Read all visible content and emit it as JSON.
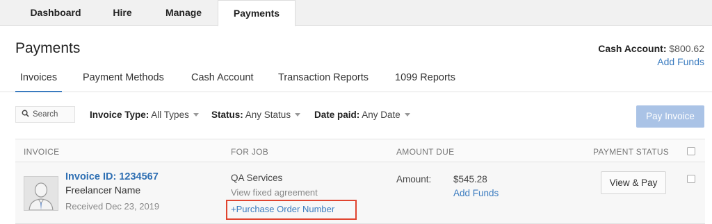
{
  "top_tabs": [
    {
      "label": "Dashboard"
    },
    {
      "label": "Hire"
    },
    {
      "label": "Manage"
    },
    {
      "label": "Payments",
      "active": true
    }
  ],
  "page": {
    "title": "Payments"
  },
  "cash_account": {
    "label": "Cash Account:",
    "amount": "$800.62",
    "add_funds": "Add Funds"
  },
  "sub_tabs": [
    {
      "label": "Invoices",
      "active": true
    },
    {
      "label": "Payment Methods"
    },
    {
      "label": "Cash Account"
    },
    {
      "label": "Transaction Reports"
    },
    {
      "label": "1099 Reports"
    }
  ],
  "filters": {
    "search_label": "Search",
    "invoice_type": {
      "label": "Invoice Type:",
      "value": "All Types"
    },
    "status": {
      "label": "Status:",
      "value": "Any Status"
    },
    "date_paid": {
      "label": "Date paid:",
      "value": "Any Date"
    },
    "pay_invoice": "Pay Invoice"
  },
  "table": {
    "headers": [
      "INVOICE",
      "FOR JOB",
      "AMOUNT DUE",
      "PAYMENT STATUS"
    ],
    "rows": [
      {
        "invoice_id": "Invoice ID: 1234567",
        "freelancer": "Freelancer Name",
        "received": "Received Dec 23, 2019",
        "job": "QA Services",
        "view_agreement": "View fixed agreement",
        "po_number": "+Purchase Order Number",
        "amount_label": "Amount:",
        "amount": "$545.28",
        "add_funds": "Add Funds",
        "action": "View & Pay"
      }
    ]
  },
  "colors": {
    "accent": "#3a7bbf",
    "highlight_border": "#e0442f",
    "disabled_button": "#aac3e6"
  }
}
